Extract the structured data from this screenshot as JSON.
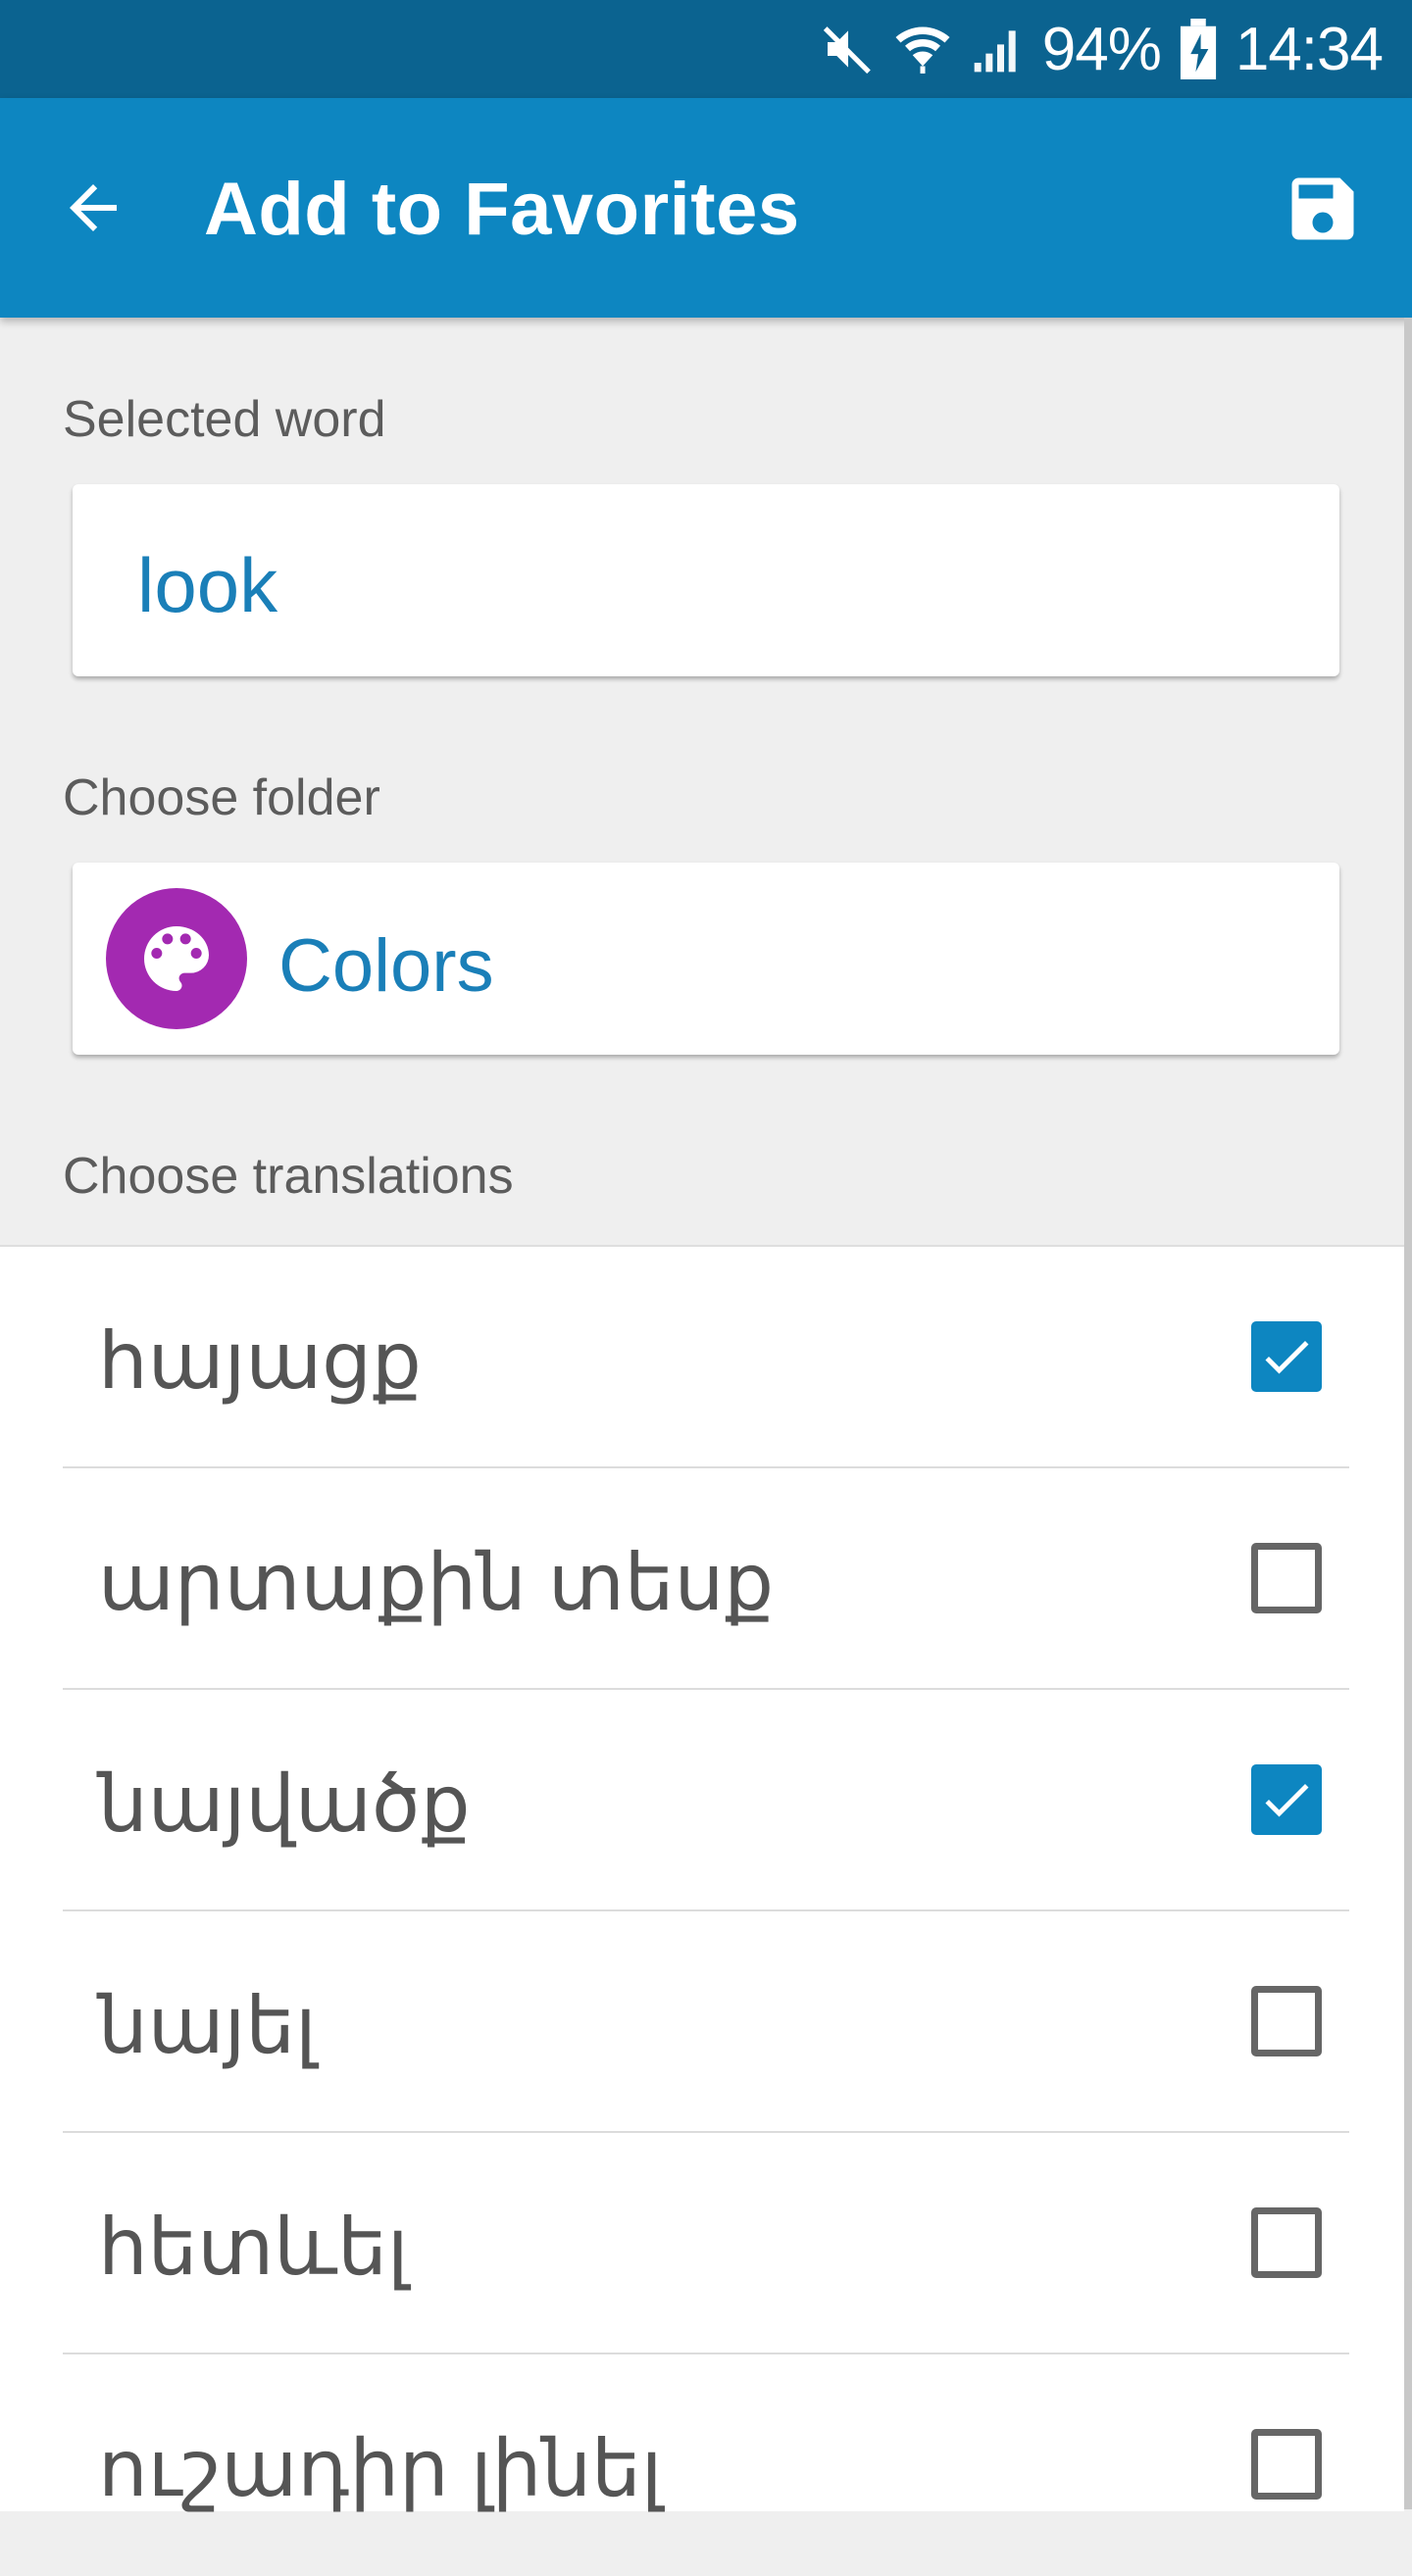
{
  "status_bar": {
    "battery": "94%",
    "time": "14:34",
    "icons": [
      "mute-icon",
      "wifi-icon",
      "signal-icon",
      "battery-charging-icon"
    ]
  },
  "app_bar": {
    "title": "Add to Favorites",
    "back_icon": "arrow-back-icon",
    "save_icon": "save-icon"
  },
  "selected_word": {
    "label": "Selected word",
    "value": "look"
  },
  "folder": {
    "label": "Choose folder",
    "name": "Colors",
    "icon": "palette-icon",
    "color": "#a329b1"
  },
  "translations": {
    "label": "Choose translations",
    "items": [
      {
        "text": "հայացք",
        "checked": true
      },
      {
        "text": "արտաքին տեսք",
        "checked": false
      },
      {
        "text": "նայվածք",
        "checked": true
      },
      {
        "text": "նայել",
        "checked": false
      },
      {
        "text": "հետևել",
        "checked": false
      },
      {
        "text": "ուշադիր լինել",
        "checked": false
      }
    ]
  },
  "colors": {
    "accent": "#0d86c1",
    "status_bar": "#0b6390",
    "link_text": "#1a7fb8"
  }
}
